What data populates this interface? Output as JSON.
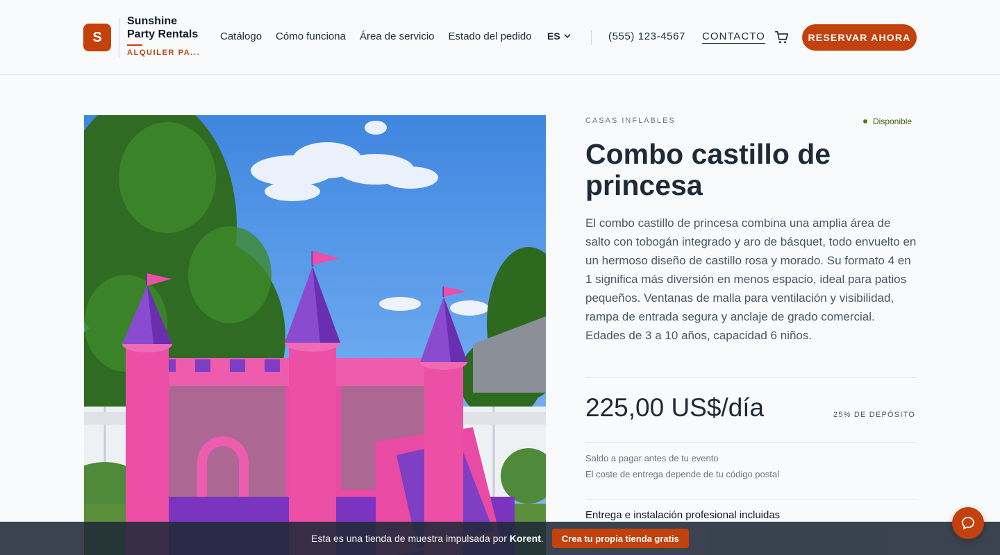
{
  "brand": {
    "logo_letter": "S",
    "name": "Sunshine Party Rentals",
    "tagline": "ALQUILER PA..."
  },
  "nav": {
    "items": [
      "Catálogo",
      "Cómo funciona",
      "Área de servicio",
      "Estado del pedido"
    ],
    "language": "ES",
    "phone": "(555) 123-4567",
    "contact": "CONTACTO",
    "reserve": "RESERVAR AHORA"
  },
  "product": {
    "category": "CASAS INFLABLES",
    "availability": "Disponible",
    "title": "Combo castillo de princesa",
    "description": "El combo castillo de princesa combina una amplia área de salto con tobogán integrado y aro de básquet, todo envuelto en un hermoso diseño de castillo rosa y morado. Su formato 4 en 1 significa más diversión en menos espacio, ideal para patios pequeños. Ventanas de malla para ventilación y visibilidad, rampa de entrada segura y anclaje de grado comercial. Edades de 3 a 10 años, capacidad 6 niños.",
    "price": "225,00 US$/día",
    "deposit": "25% DE DEPÓSITO",
    "note_balance": "Saldo a pagar antes de tu evento",
    "note_delivery": "El coste de entrega depende de tu código postal",
    "included": "Entrega e instalación profesional incluidas"
  },
  "banner": {
    "text_prefix": "Esta es una tienda de muestra impulsada por",
    "brand": "Korent",
    "text_suffix": ".",
    "button": "Crea tu propia tienda gratis"
  },
  "icons": {
    "cart": "cart-icon",
    "chevron": "chevron-down-icon",
    "chat": "chat-icon"
  },
  "colors": {
    "accent": "#c2410c",
    "available": "#4d7c0f",
    "castle_pink": "#ec4fa6",
    "castle_purple": "#7e3fc4"
  }
}
